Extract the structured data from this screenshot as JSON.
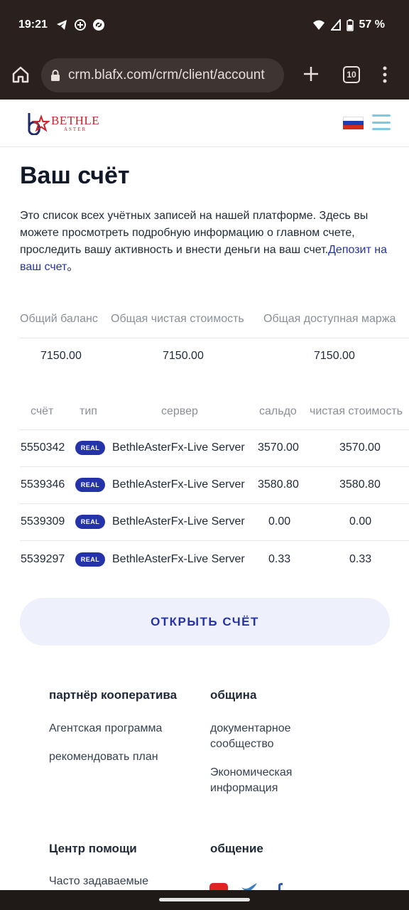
{
  "status_bar": {
    "time": "19:21",
    "battery": "57 %"
  },
  "browser": {
    "url": "crm.blafx.com/crm/client/account",
    "tab_count": "10"
  },
  "header": {
    "logo_name": "BETHLE",
    "logo_sub": "ASTER"
  },
  "main": {
    "title": "Ваш счёт",
    "intro_text": "Это список всех учётных записей на нашей платформе. Здесь вы можете просмотреть подробную информацию о главном счете, проследить вашу активность и внести деньги на ваш счет.",
    "intro_link": "Депозит на ваш счет",
    "intro_end": "。"
  },
  "summary": {
    "headers": [
      "Общий баланс",
      "Общая чистая стоимость",
      "Общая доступная маржа"
    ],
    "values": [
      "7150.00",
      "7150.00",
      "7150.00"
    ]
  },
  "accounts": {
    "headers": [
      "счёт",
      "тип",
      "сервер",
      "сальдо",
      "чистая стоимость"
    ],
    "rows": [
      {
        "account": "5550342",
        "type": "REAL",
        "server": "BethleAsterFx-Live Server",
        "balance": "3570.00",
        "equity": "3570.00"
      },
      {
        "account": "5539346",
        "type": "REAL",
        "server": "BethleAsterFx-Live Server",
        "balance": "3580.80",
        "equity": "3580.80"
      },
      {
        "account": "5539309",
        "type": "REAL",
        "server": "BethleAsterFx-Live Server",
        "balance": "0.00",
        "equity": "0.00"
      },
      {
        "account": "5539297",
        "type": "REAL",
        "server": "BethleAsterFx-Live Server",
        "balance": "0.33",
        "equity": "0.33"
      }
    ]
  },
  "open_account_label": "ОТКРЫТЬ СЧЁТ",
  "footer": {
    "partner_title": "партнёр кооператива",
    "partner_links": [
      "Агентская программа",
      "рекомендовать план"
    ],
    "community_title": "община",
    "community_links": [
      "документарное сообщество",
      "Экономическая информация"
    ],
    "help_title": "Центр помощи",
    "help_links": [
      "Часто задаваемые"
    ],
    "social_title": "общение",
    "social_icons": [
      "youtube-icon",
      "twitter-icon",
      "facebook-icon"
    ]
  },
  "colors": {
    "accent": "#2433a8",
    "logo_red": "#c9252c",
    "chrome_dark": "#2a211e"
  }
}
